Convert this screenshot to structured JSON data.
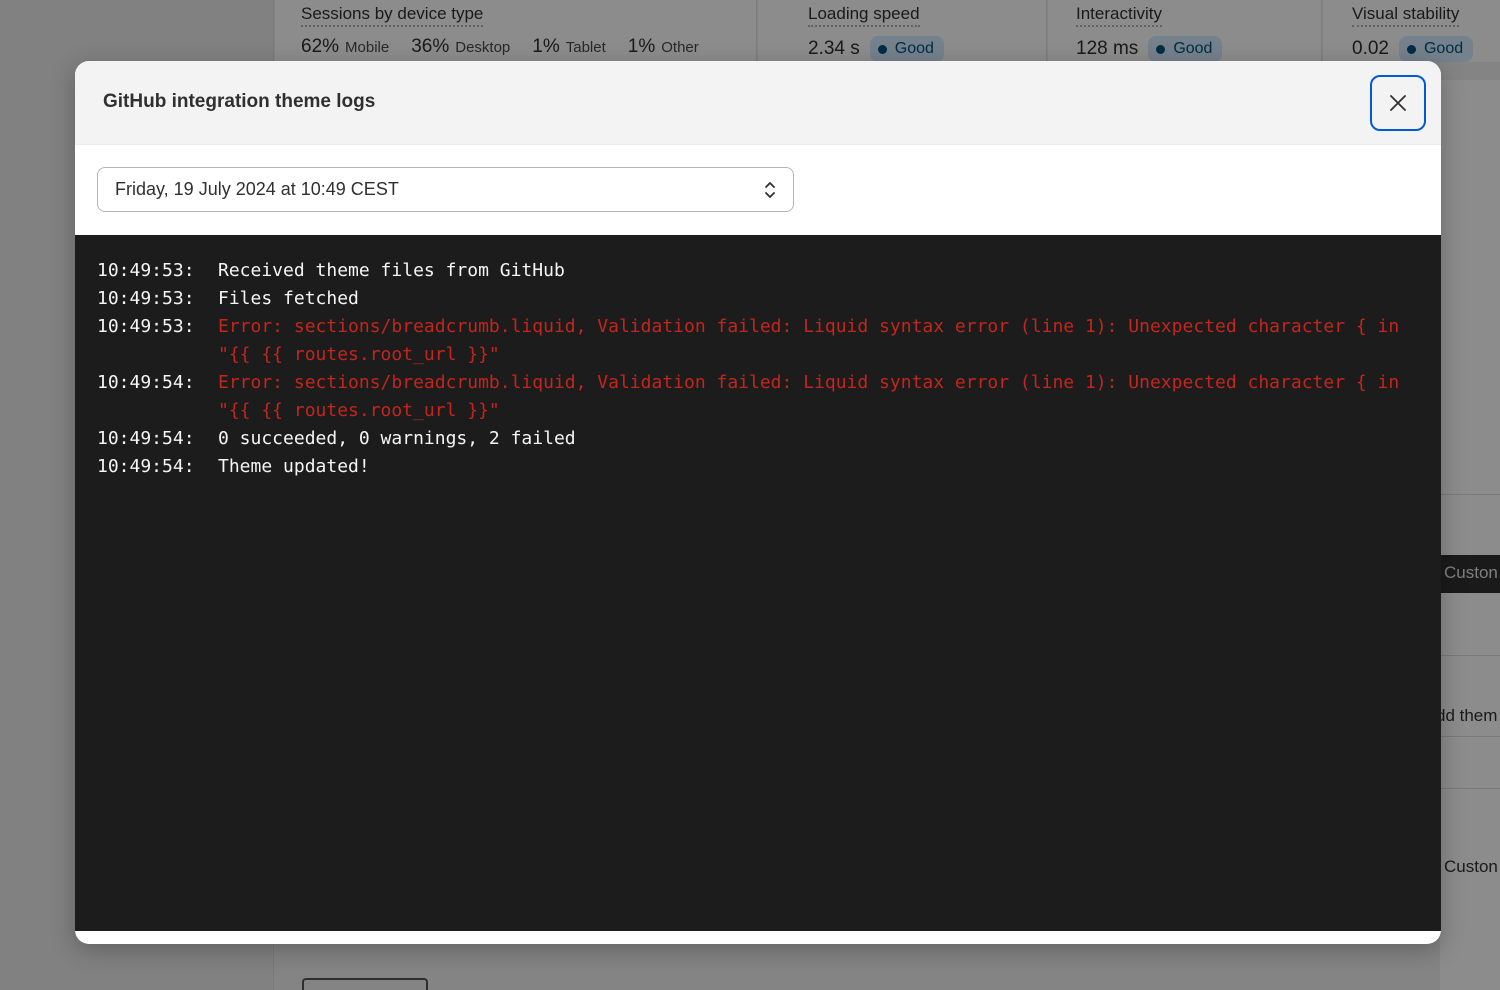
{
  "background": {
    "sessions": {
      "title": "Sessions by device type",
      "items": [
        {
          "pct": "62%",
          "label": "Mobile"
        },
        {
          "pct": "36%",
          "label": "Desktop"
        },
        {
          "pct": "1%",
          "label": "Tablet"
        },
        {
          "pct": "1%",
          "label": "Other"
        }
      ]
    },
    "loading_speed": {
      "title": "Loading speed",
      "value": "2.34 s",
      "badge": "Good"
    },
    "interactivity": {
      "title": "Interactivity",
      "value": "128 ms",
      "badge": "Good"
    },
    "visual_stability": {
      "title": "Visual stability",
      "value": "0.02",
      "badge": "Good"
    },
    "right_fragments": [
      "Custon",
      "dd them",
      "Custon"
    ]
  },
  "modal": {
    "title": "GitHub integration theme logs",
    "close_icon": "close-icon",
    "date_select": {
      "value": "Friday, 19 July 2024 at 10:49 CEST",
      "icon": "select-chevrons-icon"
    },
    "logs": [
      {
        "time": "10:49:53:",
        "message": "Received theme files from GitHub",
        "level": "info"
      },
      {
        "time": "10:49:53:",
        "message": "Files fetched",
        "level": "info"
      },
      {
        "time": "10:49:53:",
        "message": "Error: sections/breadcrumb.liquid, Validation failed: Liquid syntax error (line 1): Unexpected character { in \"{{ {{ routes.root_url }}\"",
        "level": "error"
      },
      {
        "time": "10:49:54:",
        "message": "Error: sections/breadcrumb.liquid, Validation failed: Liquid syntax error (line 1): Unexpected character { in \"{{ {{ routes.root_url }}\"",
        "level": "error"
      },
      {
        "time": "10:49:54:",
        "message": "0 succeeded, 0 warnings, 2 failed",
        "level": "info"
      },
      {
        "time": "10:49:54:",
        "message": "Theme updated!",
        "level": "info"
      }
    ]
  },
  "colors": {
    "error": "#c3261c",
    "log_background": "#1c1c1c",
    "focus_ring": "#005bd3",
    "badge_background": "#d5ebff"
  }
}
